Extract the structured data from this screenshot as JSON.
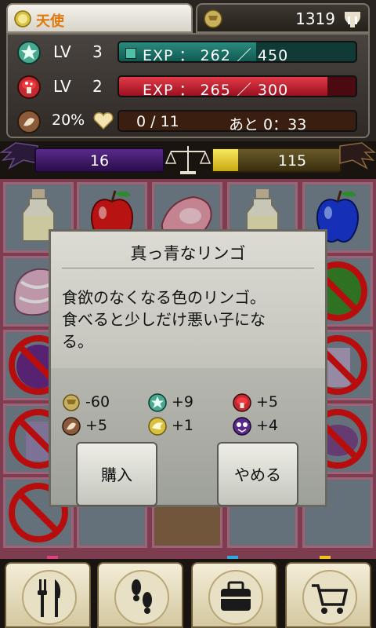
{
  "header": {
    "title": "天使",
    "money": "1319"
  },
  "stats": {
    "green": {
      "lv_label": "LV",
      "lv": "3",
      "exp_text": "EXP ： 262 ／ 450",
      "progress": 0.58
    },
    "red": {
      "lv_label": "LV",
      "lv": "2",
      "exp_text": "EXP ： 265 ／ 300",
      "progress": 0.88
    },
    "hunger": {
      "percent": "20%",
      "count": "0 / 11",
      "remaining": "あと 0：33"
    }
  },
  "balance": {
    "dark": "16",
    "light": "115"
  },
  "dialog": {
    "title": "真っ青なリンゴ",
    "description_line1": "食欲のなくなる色のリンゴ。",
    "description_line2": "食べると少しだけ悪い子にな",
    "description_line3": "る。",
    "effects": [
      {
        "icon": "gold-coin-icon",
        "value": "-60"
      },
      {
        "icon": "green-star-icon",
        "value": "+9"
      },
      {
        "icon": "red-mushroom-icon",
        "value": "+5"
      },
      {
        "icon": "brown-food-icon",
        "value": "+5"
      },
      {
        "icon": "yellow-wing-icon",
        "value": "+1"
      },
      {
        "icon": "purple-dark-icon",
        "value": "+4"
      }
    ],
    "buy_label": "購入",
    "cancel_label": "やめる"
  },
  "nav": [
    {
      "icon": "fork-knife-icon"
    },
    {
      "icon": "footprints-icon"
    },
    {
      "icon": "bag-icon"
    },
    {
      "icon": "shopping-cart-icon"
    }
  ],
  "colors": {
    "accent_orange": "#e07a10",
    "exp_green": "#105a52",
    "exp_red": "#9a1020",
    "grid_border": "#c07890"
  }
}
